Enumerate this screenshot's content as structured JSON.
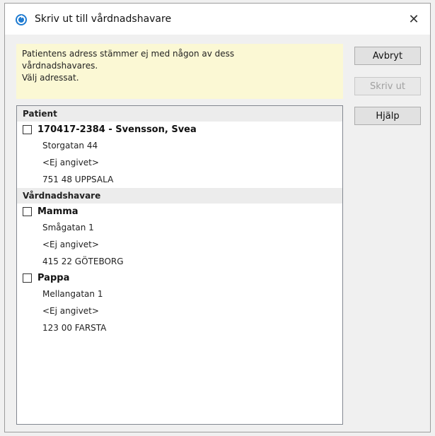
{
  "window": {
    "title": "Skriv ut till vårdnadshavare",
    "close_symbol": "✕",
    "icon": "app-refresh-icon"
  },
  "notice": {
    "lines": [
      "Patientens adress stämmer ej med någon av dess",
      "vårdnadshavares.",
      "Välj adressat."
    ]
  },
  "buttons": {
    "cancel": "Avbryt",
    "print": "Skriv ut",
    "help": "Hjälp"
  },
  "list": {
    "patient_group": "Patient",
    "patient": {
      "name": "170417-2384 - Svensson, Svea",
      "checked": false,
      "address": [
        "Storgatan 44",
        "<Ej angivet>",
        "751 48  UPPSALA"
      ]
    },
    "guardian_group": "Vårdnadshavare",
    "guardians": [
      {
        "name": "Mamma",
        "checked": false,
        "address": [
          "Smågatan 1",
          "<Ej angivet>",
          "415 22  GÖTEBORG"
        ]
      },
      {
        "name": "Pappa",
        "checked": false,
        "address": [
          "Mellangatan 1",
          "<Ej angivet>",
          "123 00  FARSTA"
        ]
      }
    ]
  }
}
